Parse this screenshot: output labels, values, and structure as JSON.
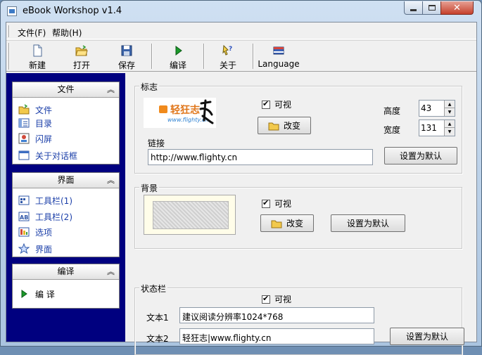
{
  "window": {
    "title": "eBook Workshop v1.4"
  },
  "menu": [
    {
      "label": "文件(F)"
    },
    {
      "label": "帮助(H)"
    }
  ],
  "toolbar": [
    {
      "label": "新建",
      "icon": "new-file-icon"
    },
    {
      "label": "打开",
      "icon": "open-folder-icon"
    },
    {
      "label": "保存",
      "icon": "save-disk-icon"
    },
    {
      "label": "编译",
      "icon": "play-arrow-icon"
    },
    {
      "label": "关于",
      "icon": "help-pointer-icon"
    },
    {
      "label": "Language",
      "icon": "language-flag-icon"
    }
  ],
  "sidebar": {
    "panels": [
      {
        "title": "文件",
        "items": [
          {
            "label": "文件",
            "icon": "folder-icon"
          },
          {
            "label": "目录",
            "icon": "catalog-icon"
          },
          {
            "label": "闪屏",
            "icon": "splash-icon"
          },
          {
            "label": "关于对话框",
            "icon": "dialog-icon"
          }
        ]
      },
      {
        "title": "界面",
        "items": [
          {
            "label": "工具栏(1)",
            "icon": "toolbar-icon"
          },
          {
            "label": "工具栏(2)",
            "icon": "toolbar-ab-icon"
          },
          {
            "label": "选项",
            "icon": "options-icon"
          },
          {
            "label": "界面",
            "icon": "star-icon"
          }
        ]
      },
      {
        "title": "编译",
        "items": [
          {
            "label": "编 译",
            "icon": "play-icon"
          }
        ]
      }
    ]
  },
  "logo_group": {
    "title": "标志",
    "visible_label": "可视",
    "change_label": "改变",
    "height_label": "高度",
    "height_value": "43",
    "width_label": "宽度",
    "width_value": "131",
    "link_label": "链接",
    "link_value": "http://www.flighty.cn",
    "default_label": "设置为默认",
    "logo_text": "轻狂志",
    "logo_url": "www.flighty.cn"
  },
  "background_group": {
    "title": "背景",
    "visible_label": "可视",
    "change_label": "改变",
    "default_label": "设置为默认"
  },
  "status_group": {
    "title": "状态栏",
    "visible_label": "可视",
    "text1_label": "文本1",
    "text1_value": "建议阅读分辨率1024*768",
    "text2_label": "文本2",
    "text2_value": "轻狂志|www.flighty.cn",
    "default_label": "设置为默认"
  },
  "colors": {
    "sidebar_bg": "#00007f",
    "link_blue": "#1a3ea8"
  }
}
